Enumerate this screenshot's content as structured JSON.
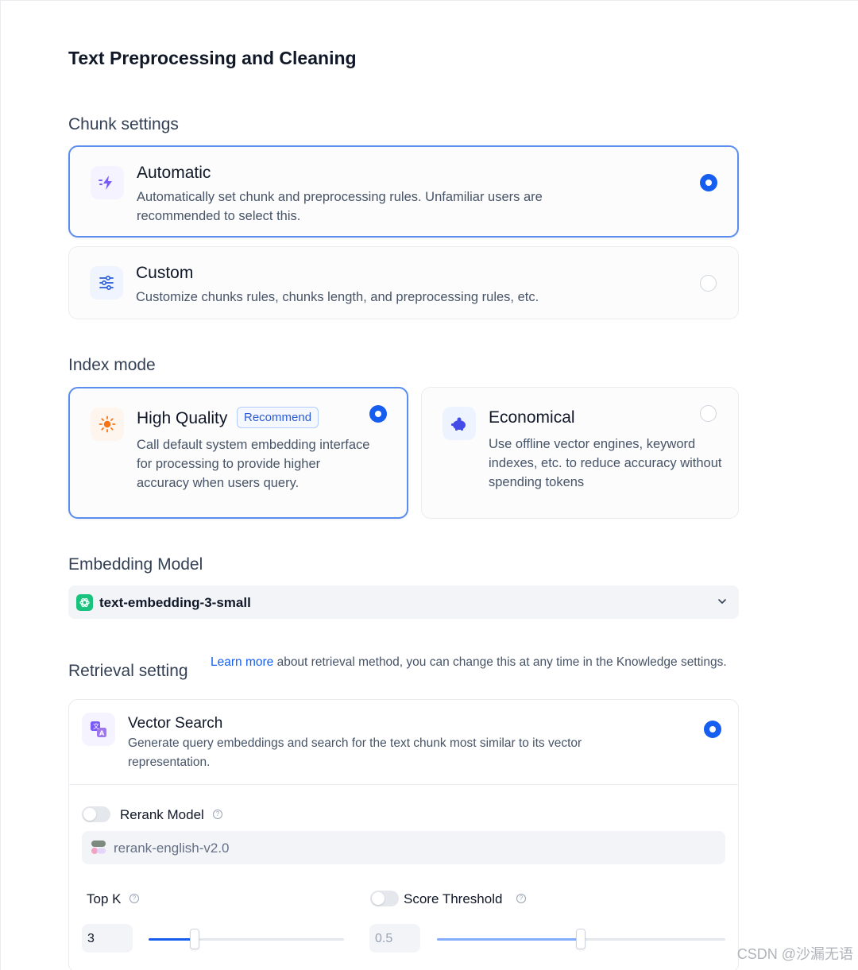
{
  "page_title": "Text Preprocessing and Cleaning",
  "chunk": {
    "label": "Chunk settings",
    "options": [
      {
        "title": "Automatic",
        "desc": "Automatically set chunk and preprocessing rules. Unfamiliar users are recommended to select this.",
        "selected": true
      },
      {
        "title": "Custom",
        "desc": "Customize chunks rules, chunks length, and preprocessing rules, etc.",
        "selected": false
      }
    ]
  },
  "index": {
    "label": "Index mode",
    "options": [
      {
        "title": "High Quality",
        "badge": "Recommend",
        "desc": "Call default system embedding interface for processing to provide higher accuracy when users query.",
        "selected": true
      },
      {
        "title": "Economical",
        "desc": "Use offline vector engines, keyword indexes, etc. to reduce accuracy without spending tokens",
        "selected": false
      }
    ]
  },
  "embedding": {
    "label": "Embedding Model",
    "value": "text-embedding-3-small"
  },
  "retrieval": {
    "label": "Retrieval setting",
    "link_text": "Learn more",
    "note": " about retrieval method, you can change this at any time in the Knowledge settings.",
    "vector_search": {
      "title": "Vector Search",
      "desc": "Generate query embeddings and search for the text chunk most similar to its vector representation.",
      "selected": true
    },
    "rerank": {
      "label": "Rerank Model",
      "enabled": false,
      "model": "rerank-english-v2.0"
    },
    "top_k": {
      "label": "Top K",
      "value": "3",
      "slider_fraction": 0.23
    },
    "score_threshold": {
      "label": "Score Threshold",
      "enabled": false,
      "value": "0.5",
      "slider_fraction": 0.5
    }
  },
  "colors": {
    "accent": "#155eef",
    "selected_border": "#5b8def"
  },
  "watermark": "CSDN @沙漏无语"
}
